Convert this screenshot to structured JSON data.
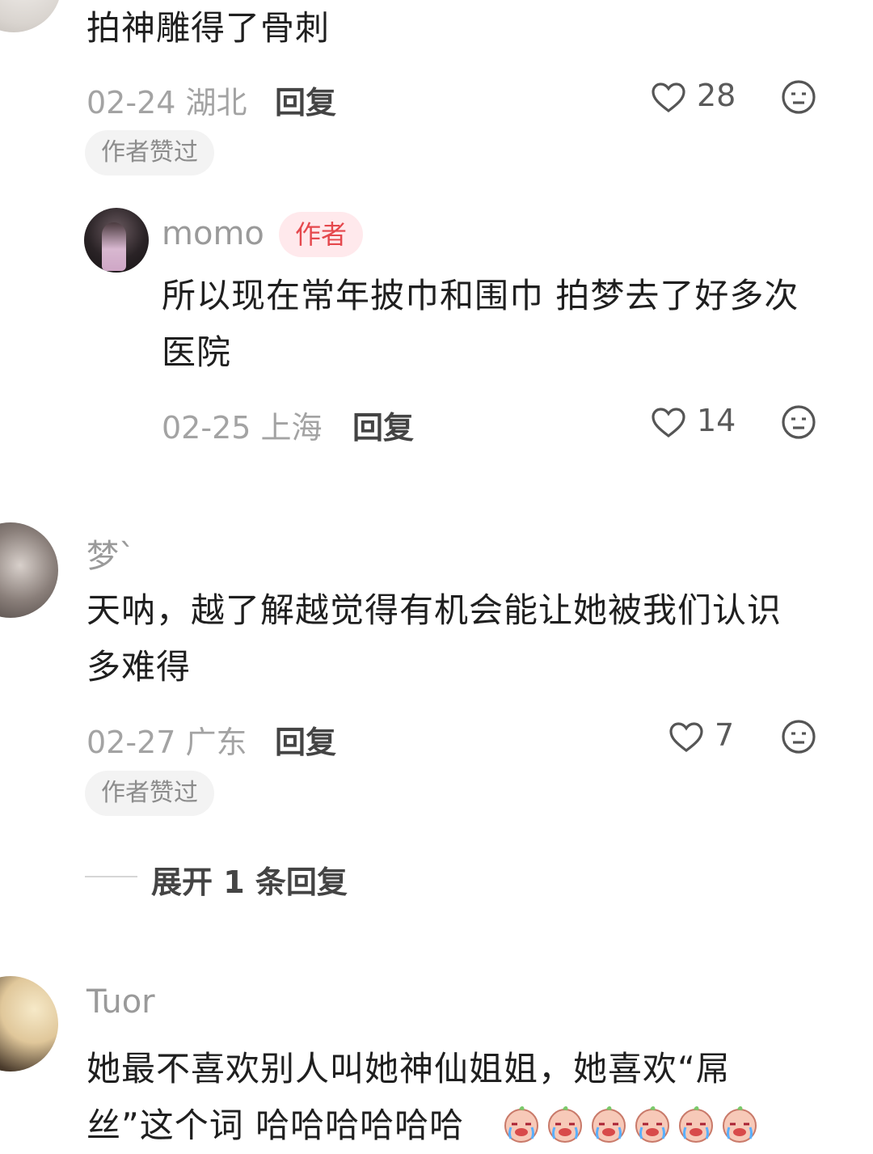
{
  "comments": [
    {
      "text": "拍神雕得了骨刺",
      "date": "02-24",
      "location": "湖北",
      "reply_label": "回复",
      "likes": "28",
      "author_liked": "作者赞过",
      "icons": [
        "heart-outline-icon",
        "dislike-face-icon"
      ]
    },
    {
      "username": "momo",
      "badge": "作者",
      "text_line1": "所以现在常年披巾和围巾 拍梦去了好多次",
      "text_line2": "医院",
      "date": "02-25",
      "location": "上海",
      "reply_label": "回复",
      "likes": "14"
    },
    {
      "username": "梦`",
      "text_line1": "天呐，越了解越觉得有机会能让她被我们认识",
      "text_line2": "多难得",
      "date": "02-27",
      "location": "广东",
      "reply_label": "回复",
      "likes": "7",
      "author_liked": "作者赞过",
      "expand_label": "展开 1 条回复"
    },
    {
      "username": "Tuor",
      "text_line1": "她最不喜欢别人叫她神仙姐姐，她喜欢“屌",
      "text_line2": "丝”这个词 哈哈哈哈哈哈",
      "emoji": "crying-laughing-baby-emoji",
      "emoji_count": 6
    }
  ],
  "colors": {
    "author_badge_bg": "#ffe9ec",
    "author_badge_text": "#e5484d",
    "meta_text": "#a3a3a3",
    "pill_bg": "#f3f3f3"
  }
}
